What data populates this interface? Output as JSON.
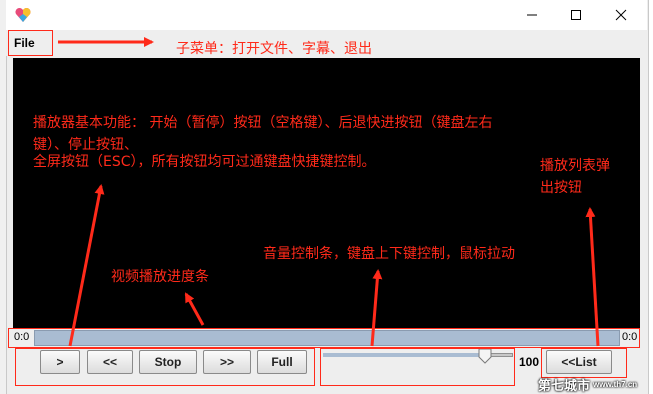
{
  "menu": {
    "file_label": "File"
  },
  "player": {
    "time_left": "0:0",
    "time_right": "0:0",
    "progress": 0.0,
    "volume_value": "100",
    "volume_fraction": 0.85,
    "buttons": {
      "play": ">",
      "rewind": "<<",
      "stop": "Stop",
      "forward": ">>",
      "full": "Full",
      "list": "<<List"
    }
  },
  "annotations": {
    "submenu": "子菜单：打开文件、字幕、退出",
    "basic_line1": "播放器基本功能： 开始（暂停）按钮（空格键）、后退快进按钮（键盘左右",
    "basic_line2": "键）、停止按钮、",
    "basic_line3": "全屏按钮（ESC），所有按钮均可过通键盘快捷键控制。",
    "playlist_line1": "播放列表弹",
    "playlist_line2": "出按钮",
    "volume": "音量控制条，键盘上下键控制，鼠标拉动",
    "progress": "视频播放进度条"
  },
  "watermark": {
    "text": "第七城市",
    "url": "www.th7.cn"
  },
  "colors": {
    "annotation": "#ff2a1a",
    "video_bg": "#000000",
    "progress": "#a9bcd2"
  }
}
